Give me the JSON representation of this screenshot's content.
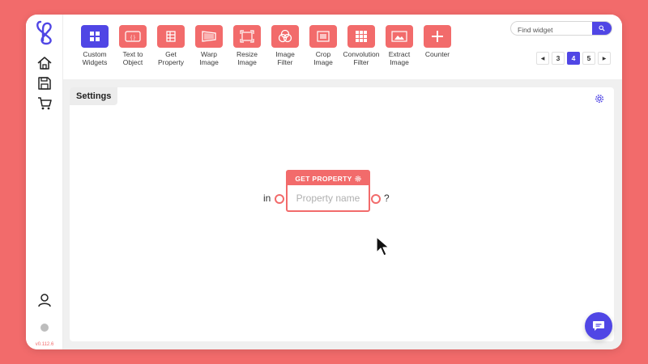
{
  "app": {
    "version": "v0.112.6"
  },
  "toolbar": {
    "widgets": [
      {
        "label": "Custom\nWidgets",
        "icon": "grid-icon",
        "primary": true
      },
      {
        "label": "Text to\nObject",
        "icon": "text-json-icon"
      },
      {
        "label": "Get\nProperty",
        "icon": "table-icon"
      },
      {
        "label": "Warp\nImage",
        "icon": "warp-icon"
      },
      {
        "label": "Resize\nImage",
        "icon": "resize-icon"
      },
      {
        "label": "Image\nFilter",
        "icon": "filter-circles-icon"
      },
      {
        "label": "Crop\nImage",
        "icon": "crop-icon"
      },
      {
        "label": "Convolution\nFilter",
        "icon": "matrix-icon"
      },
      {
        "label": "Extract\nImage",
        "icon": "extract-icon"
      },
      {
        "label": "Counter",
        "icon": "plus-icon"
      }
    ],
    "search": {
      "placeholder": "Find widget"
    },
    "pager": {
      "prev": "◀",
      "pages": [
        "3",
        "4",
        "5"
      ],
      "active": "4",
      "next": "▶"
    }
  },
  "canvas": {
    "tab_label": "Settings",
    "node": {
      "title": "GET PROPERTY",
      "input_placeholder": "Property name",
      "in_label": "in",
      "out_label": "?"
    }
  },
  "colors": {
    "background": "#f26b6b",
    "accent": "#5046e5",
    "node": "#f26b6b"
  }
}
